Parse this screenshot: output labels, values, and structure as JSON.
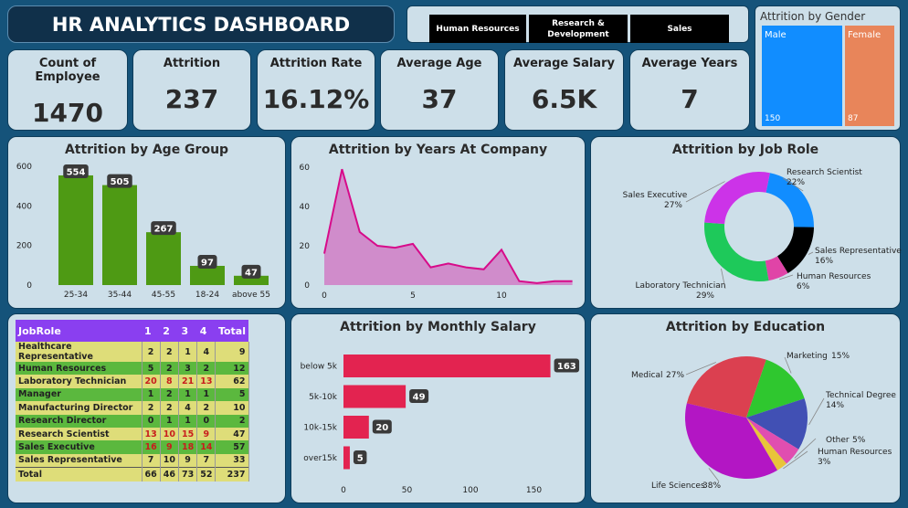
{
  "header": {
    "title": "HR ANALYTICS DASHBOARD"
  },
  "slicer": {
    "buttons": [
      "Human Resources",
      "Research & Development",
      "Sales"
    ]
  },
  "kpis": [
    {
      "label": "Count of Employee",
      "value": "1470"
    },
    {
      "label": "Attrition",
      "value": "237"
    },
    {
      "label": "Attrition Rate",
      "value": "16.12%"
    },
    {
      "label": "Average Age",
      "value": "37"
    },
    {
      "label": "Average Salary",
      "value": "6.5K"
    },
    {
      "label": "Average Years",
      "value": "7"
    }
  ],
  "gender": {
    "title": "Attrition by Gender",
    "male_label": "Male",
    "male_value": "150",
    "female_label": "Female",
    "female_value": "87",
    "male_color": "#118dff",
    "female_color": "#e8855a"
  },
  "age": {
    "title": "Attrition by Age Group"
  },
  "years": {
    "title": "Attrition by Years At Company"
  },
  "role": {
    "title": "Attrition by Job Role"
  },
  "salary": {
    "title": "Attrition by Monthly Salary"
  },
  "education": {
    "title": "Attrition by Education"
  },
  "matrix": {
    "headers": [
      "JobRole",
      "1",
      "2",
      "3",
      "4",
      "Total"
    ],
    "rows": [
      {
        "role": "Healthcare Representative",
        "v": [
          "2",
          "2",
          "1",
          "4"
        ],
        "total": "9"
      },
      {
        "role": "Human Resources",
        "v": [
          "5",
          "2",
          "3",
          "2"
        ],
        "total": "12"
      },
      {
        "role": "Laboratory Technician",
        "v": [
          "20",
          "8",
          "21",
          "13"
        ],
        "total": "62"
      },
      {
        "role": "Manager",
        "v": [
          "1",
          "2",
          "1",
          "1"
        ],
        "total": "5"
      },
      {
        "role": "Manufacturing Director",
        "v": [
          "2",
          "2",
          "4",
          "2"
        ],
        "total": "10"
      },
      {
        "role": "Research Director",
        "v": [
          "0",
          "1",
          "1",
          "0"
        ],
        "total": "2"
      },
      {
        "role": "Research Scientist",
        "v": [
          "13",
          "10",
          "15",
          "9"
        ],
        "total": "47"
      },
      {
        "role": "Sales Executive",
        "v": [
          "16",
          "9",
          "18",
          "14"
        ],
        "total": "57"
      },
      {
        "role": "Sales Representative",
        "v": [
          "7",
          "10",
          "9",
          "7"
        ],
        "total": "33"
      }
    ],
    "total": {
      "role": "Total",
      "v": [
        "66",
        "46",
        "73",
        "52"
      ],
      "total": "237"
    }
  },
  "chart_data": [
    {
      "type": "bar",
      "title": "Attrition by Age Group",
      "categories": [
        "25-34",
        "35-44",
        "45-55",
        "18-24",
        "above 55"
      ],
      "values": [
        554,
        505,
        267,
        97,
        47
      ],
      "ylim": [
        0,
        600
      ],
      "yticks": [
        0,
        200,
        400,
        600
      ],
      "color": "#4e9a14"
    },
    {
      "type": "area",
      "title": "Attrition by Years At Company",
      "x": [
        0,
        1,
        2,
        3,
        4,
        5,
        6,
        7,
        8,
        9,
        10,
        11,
        12,
        13,
        14
      ],
      "y": [
        16,
        59,
        27,
        20,
        19,
        21,
        9,
        11,
        9,
        8,
        18,
        2,
        1,
        2,
        2
      ],
      "ylim": [
        0,
        60
      ],
      "yticks": [
        0,
        20,
        40,
        60
      ],
      "xticks": [
        0,
        5,
        10
      ],
      "color": "#d70b8a"
    },
    {
      "type": "pie",
      "title": "Attrition by Job Role",
      "donut": true,
      "slices": [
        {
          "label": "Research Scientist",
          "pct": "22%",
          "value": 22,
          "color": "#118dff"
        },
        {
          "label": "Sales Representative",
          "pct": "16%",
          "value": 16,
          "color": "#000000"
        },
        {
          "label": "Human Resources",
          "pct": "6%",
          "value": 6,
          "color": "#e044a7"
        },
        {
          "label": "Laboratory Technician",
          "pct": "29%",
          "value": 29,
          "color": "#1ec95a"
        },
        {
          "label": "Sales Executive",
          "pct": "27%",
          "value": 27,
          "color": "#cc33e8"
        }
      ]
    },
    {
      "type": "bar",
      "orientation": "horizontal",
      "title": "Attrition by Monthly Salary",
      "categories": [
        "below 5k",
        "5k-10k",
        "10k-15k",
        "over15k"
      ],
      "values": [
        163,
        49,
        20,
        5
      ],
      "xlim": [
        0,
        175
      ],
      "xticks": [
        0,
        50,
        100,
        150
      ],
      "color": "#e32350"
    },
    {
      "type": "pie",
      "title": "Attrition by Education",
      "slices": [
        {
          "label": "Marketing",
          "pct": "15%",
          "value": 15,
          "color": "#2fc72f"
        },
        {
          "label": "Technical Degree",
          "pct": "14%",
          "value": 14,
          "color": "#4150b4"
        },
        {
          "label": "Other",
          "pct": "5%",
          "value": 5,
          "color": "#e04eb0"
        },
        {
          "label": "Human Resources",
          "pct": "3%",
          "value": 3,
          "color": "#e8c43a"
        },
        {
          "label": "Life Sciences",
          "pct": "38%",
          "value": 38,
          "color": "#b316c4"
        },
        {
          "label": "Medical",
          "pct": "27%",
          "value": 27,
          "color": "#db4050"
        }
      ]
    }
  ]
}
